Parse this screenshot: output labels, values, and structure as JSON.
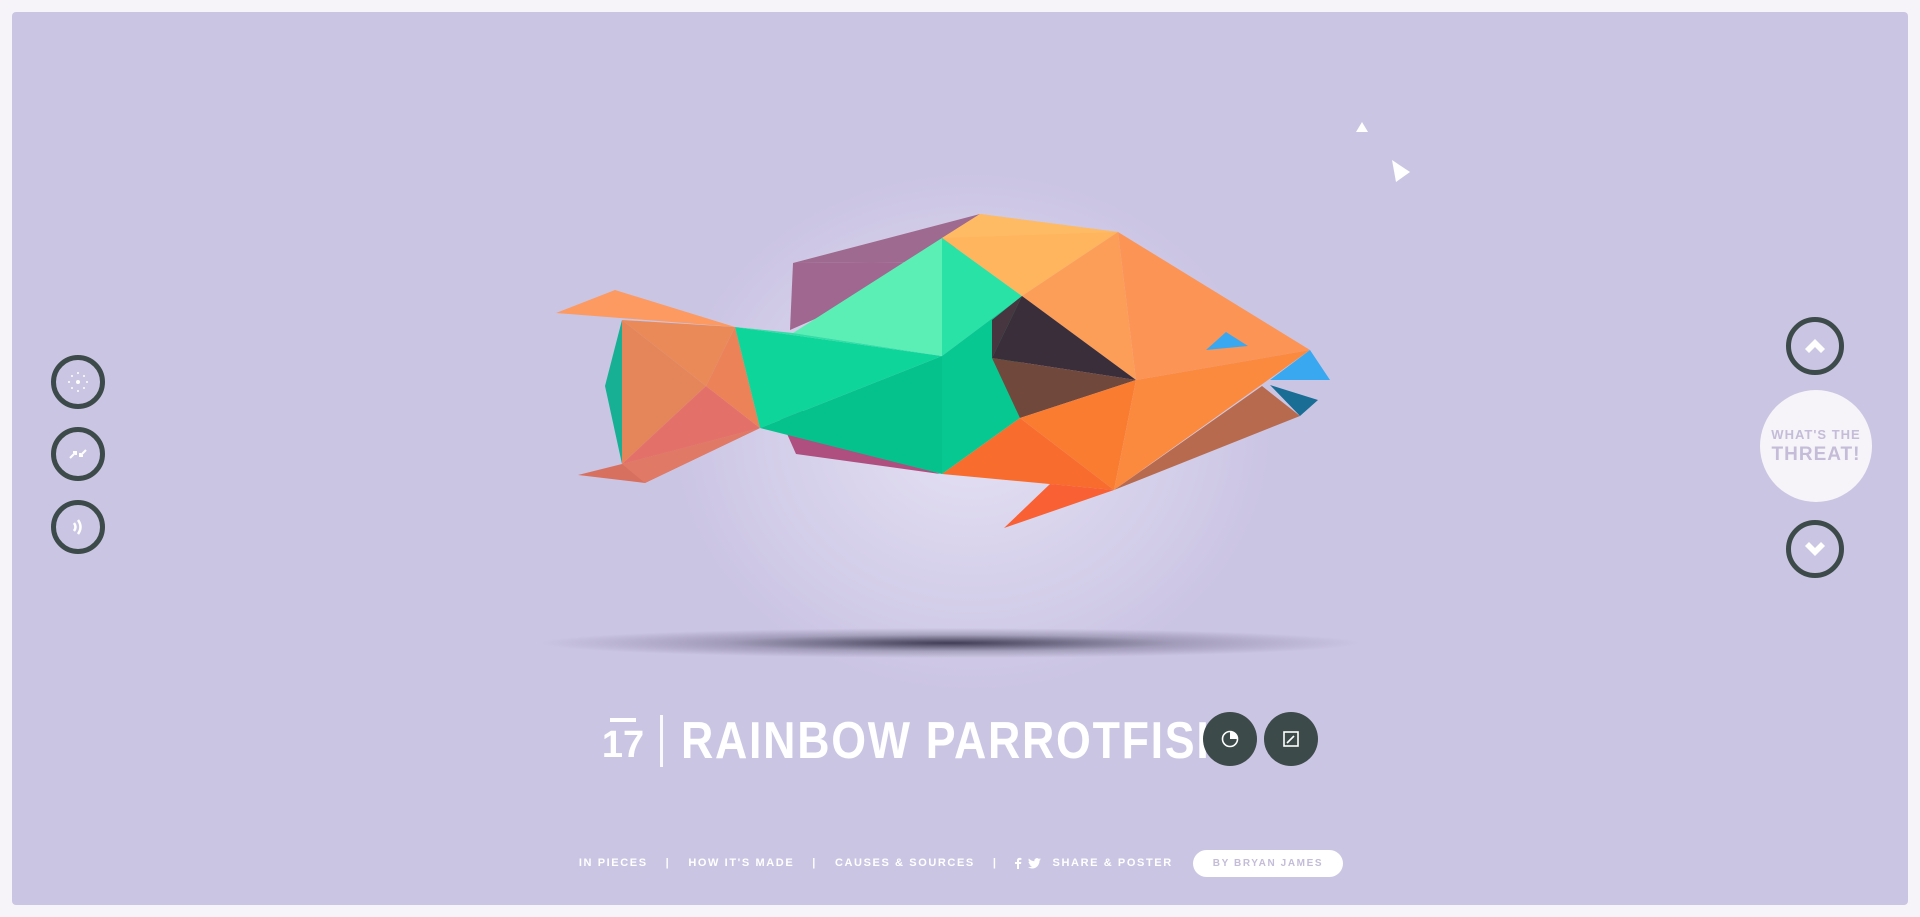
{
  "app": {
    "accent_background": "#cbc5e4",
    "button_color": "#3d4a4a"
  },
  "left_controls": [
    {
      "icon": "dots-circle-icon",
      "name": "Fullscreen"
    },
    {
      "icon": "shuffle-arrows-icon",
      "name": "Shuffle"
    },
    {
      "icon": "sound-waves-icon",
      "name": "Sound"
    }
  ],
  "right_nav": {
    "up_icon": "chevron-up-icon",
    "down_icon": "chevron-down-icon",
    "threat_line1": "WHAT'S THE",
    "threat_line2": "THREAT!"
  },
  "species": {
    "number": "17",
    "name": "RAINBOW PARROTFISH",
    "icons": [
      "pie-chart-icon",
      "edit-icon"
    ]
  },
  "footer": {
    "links": [
      "IN PIECES",
      "HOW IT'S MADE",
      "CAUSES & SOURCES"
    ],
    "separator": "|",
    "share_label": "SHARE & POSTER",
    "share_icons": [
      "facebook-icon",
      "twitter-icon"
    ],
    "author": "BY BRYAN JAMES"
  }
}
